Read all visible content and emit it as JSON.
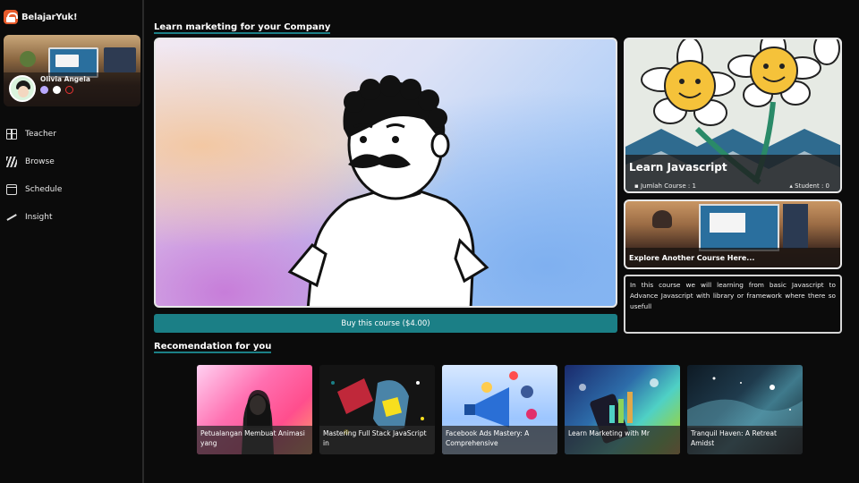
{
  "brand": {
    "name": "BelajarYuk!",
    "logo_icon": "lock-bag-icon",
    "logo_color": "#e85c2c"
  },
  "profile": {
    "name": "Olivia Angela",
    "icons": [
      "moon-icon",
      "github-icon",
      "power-icon"
    ]
  },
  "sidebar": {
    "items": [
      {
        "label": "Teacher",
        "icon": "grid-icon"
      },
      {
        "label": "Browse",
        "icon": "browse-icon"
      },
      {
        "label": "Schedule",
        "icon": "calendar-icon"
      },
      {
        "label": "Insight",
        "icon": "insight-icon"
      }
    ]
  },
  "main": {
    "section_title": "Learn marketing for your Company",
    "buy_button": "Buy this course ($4.00)",
    "accent_color": "#1b7f86"
  },
  "course_card": {
    "title": "Learn Javascript",
    "jumlah_course": "Jumlah Course : 1",
    "student": "Student : 0"
  },
  "explore_card": {
    "label": "Explore Another Course Here..."
  },
  "description": "In this course we will learning from basic Javascript to Advance Javascript with library or framework where there so usefull",
  "recommendation": {
    "title": "Recomendation for you",
    "items": [
      {
        "title": "Petualangan Membuat Animasi yang"
      },
      {
        "title": "Mastering Full Stack JavaScript in"
      },
      {
        "title": "Facebook Ads Mastery: A Comprehensive"
      },
      {
        "title": "Learn Marketing with Mr"
      },
      {
        "title": "Tranquil Haven: A Retreat Amidst"
      }
    ]
  }
}
